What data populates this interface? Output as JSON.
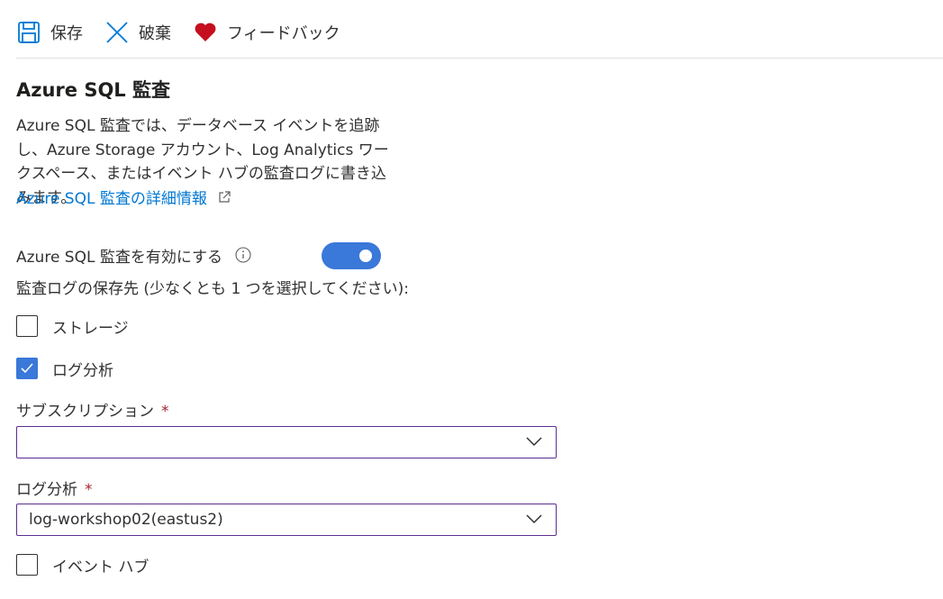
{
  "toolbar": {
    "save_label": "保存",
    "discard_label": "破棄",
    "feedback_label": "フィードバック"
  },
  "page": {
    "title": "Azure SQL 監査",
    "description": "Azure SQL 監査では、データベース イベントを追跡し、Azure Storage アカウント、Log Analytics ワークスペース、またはイベント ハブの監査ログに書き込みます。",
    "learn_more_link": "Azure SQL 監査の詳細情報"
  },
  "enable_auditing": {
    "label": "Azure SQL 監査を有効にする",
    "enabled": true
  },
  "destinations": {
    "label": "監査ログの保存先 (少なくとも 1 つを選択してください):",
    "storage": {
      "label": "ストレージ",
      "checked": false
    },
    "log_analytics": {
      "label": "ログ分析",
      "checked": true
    },
    "event_hub": {
      "label": "イベント ハブ",
      "checked": false
    }
  },
  "subscription": {
    "label": "サブスクリプション",
    "required_mark": "*",
    "value": "",
    "value_obscured": true
  },
  "log_analytics_workspace": {
    "label": "ログ分析",
    "required_mark": "*",
    "value": "log-workshop02(eastus2)"
  },
  "colors": {
    "accent": "#3a78d9",
    "link": "#0078d4",
    "required": "#a4262c",
    "dropdown_border": "#5c2d91",
    "feedback_heart": "#c50f1f"
  }
}
